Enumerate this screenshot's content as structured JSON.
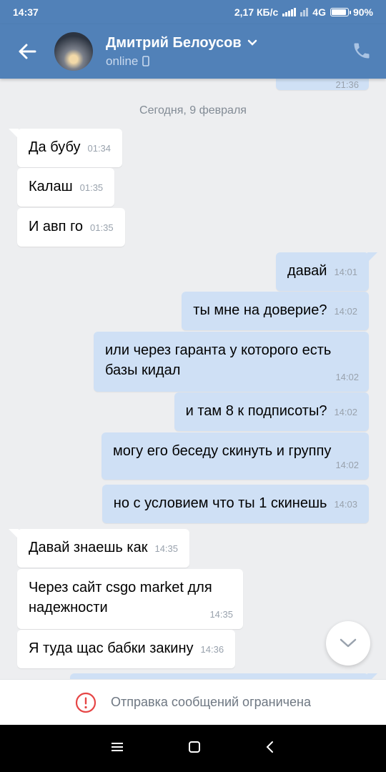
{
  "status_bar": {
    "time": "14:37",
    "net_speed": "2,17 КБ/с",
    "network": "4G",
    "battery": "90%",
    "battery_fraction": 0.9
  },
  "header": {
    "name": "Дмитрий Белоусов",
    "status": "online"
  },
  "partial_top_time": "21:36",
  "date_separator": "Сегодня, 9 февраля",
  "messages": [
    {
      "dir": "in",
      "text": "Да бубу",
      "time": "01:34"
    },
    {
      "dir": "in",
      "text": "Калаш",
      "time": "01:35"
    },
    {
      "dir": "in",
      "text": "И авп го",
      "time": "01:35"
    },
    {
      "dir": "out",
      "text": "давай",
      "time": "14:01"
    },
    {
      "dir": "out",
      "text": "ты мне на доверие?",
      "time": "14:02"
    },
    {
      "dir": "out",
      "text": "или через гаранта у которого есть базы кидал",
      "time": "14:02"
    },
    {
      "dir": "out",
      "text": "и там 8 к подписоты?",
      "time": "14:02"
    },
    {
      "dir": "out",
      "text": "могу его беседу скинуть и группу",
      "time": "14:02"
    },
    {
      "dir": "out",
      "text": "но с условием что ты 1 скинешь",
      "time": "14:03"
    },
    {
      "dir": "in",
      "text": "Давай знаешь как",
      "time": "14:35"
    },
    {
      "dir": "in",
      "text": "Через сайт csgo market для надежности",
      "time": "14:35"
    },
    {
      "dir": "in",
      "text": "Я туда щас бабки закину",
      "time": "14:36"
    }
  ],
  "restricted_notice": "Отправка сообщений ограничена",
  "icons": {
    "back": "arrow-left-icon",
    "phone": "phone-icon",
    "dropdown": "chevron-down-icon",
    "mobile": "mobile-icon",
    "scroll": "chevron-down-icon",
    "warning": "exclamation-circle-icon",
    "nav_menu": "menu-icon",
    "nav_home": "square-icon",
    "nav_back": "back-icon"
  },
  "colors": {
    "accent": "#5181b8",
    "out_bubble": "#cfe0f5",
    "in_bubble": "#ffffff",
    "background": "#edeef0",
    "warning": "#e64646"
  }
}
